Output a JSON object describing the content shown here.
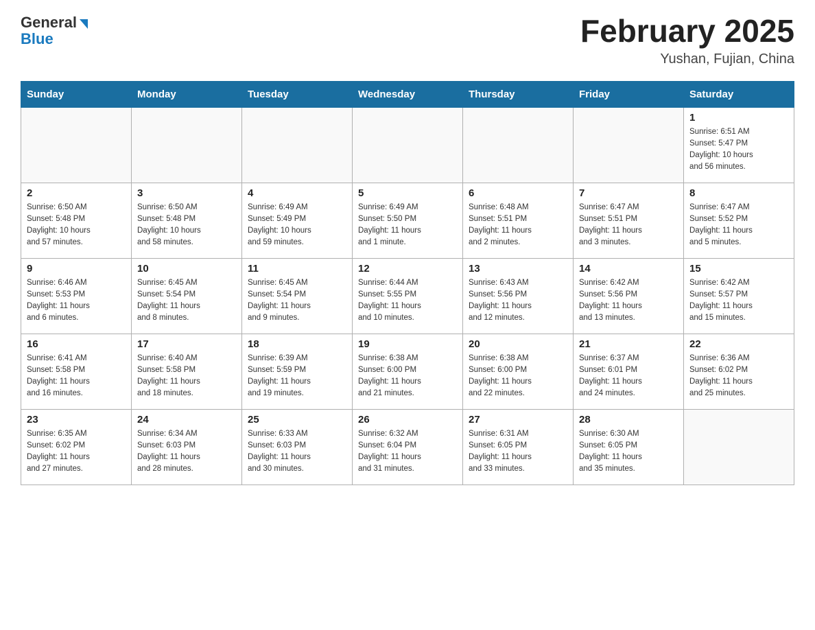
{
  "header": {
    "logo_general": "General",
    "logo_blue": "Blue",
    "title": "February 2025",
    "subtitle": "Yushan, Fujian, China"
  },
  "weekdays": [
    "Sunday",
    "Monday",
    "Tuesday",
    "Wednesday",
    "Thursday",
    "Friday",
    "Saturday"
  ],
  "weeks": [
    [
      {
        "day": "",
        "info": ""
      },
      {
        "day": "",
        "info": ""
      },
      {
        "day": "",
        "info": ""
      },
      {
        "day": "",
        "info": ""
      },
      {
        "day": "",
        "info": ""
      },
      {
        "day": "",
        "info": ""
      },
      {
        "day": "1",
        "info": "Sunrise: 6:51 AM\nSunset: 5:47 PM\nDaylight: 10 hours\nand 56 minutes."
      }
    ],
    [
      {
        "day": "2",
        "info": "Sunrise: 6:50 AM\nSunset: 5:48 PM\nDaylight: 10 hours\nand 57 minutes."
      },
      {
        "day": "3",
        "info": "Sunrise: 6:50 AM\nSunset: 5:48 PM\nDaylight: 10 hours\nand 58 minutes."
      },
      {
        "day": "4",
        "info": "Sunrise: 6:49 AM\nSunset: 5:49 PM\nDaylight: 10 hours\nand 59 minutes."
      },
      {
        "day": "5",
        "info": "Sunrise: 6:49 AM\nSunset: 5:50 PM\nDaylight: 11 hours\nand 1 minute."
      },
      {
        "day": "6",
        "info": "Sunrise: 6:48 AM\nSunset: 5:51 PM\nDaylight: 11 hours\nand 2 minutes."
      },
      {
        "day": "7",
        "info": "Sunrise: 6:47 AM\nSunset: 5:51 PM\nDaylight: 11 hours\nand 3 minutes."
      },
      {
        "day": "8",
        "info": "Sunrise: 6:47 AM\nSunset: 5:52 PM\nDaylight: 11 hours\nand 5 minutes."
      }
    ],
    [
      {
        "day": "9",
        "info": "Sunrise: 6:46 AM\nSunset: 5:53 PM\nDaylight: 11 hours\nand 6 minutes."
      },
      {
        "day": "10",
        "info": "Sunrise: 6:45 AM\nSunset: 5:54 PM\nDaylight: 11 hours\nand 8 minutes."
      },
      {
        "day": "11",
        "info": "Sunrise: 6:45 AM\nSunset: 5:54 PM\nDaylight: 11 hours\nand 9 minutes."
      },
      {
        "day": "12",
        "info": "Sunrise: 6:44 AM\nSunset: 5:55 PM\nDaylight: 11 hours\nand 10 minutes."
      },
      {
        "day": "13",
        "info": "Sunrise: 6:43 AM\nSunset: 5:56 PM\nDaylight: 11 hours\nand 12 minutes."
      },
      {
        "day": "14",
        "info": "Sunrise: 6:42 AM\nSunset: 5:56 PM\nDaylight: 11 hours\nand 13 minutes."
      },
      {
        "day": "15",
        "info": "Sunrise: 6:42 AM\nSunset: 5:57 PM\nDaylight: 11 hours\nand 15 minutes."
      }
    ],
    [
      {
        "day": "16",
        "info": "Sunrise: 6:41 AM\nSunset: 5:58 PM\nDaylight: 11 hours\nand 16 minutes."
      },
      {
        "day": "17",
        "info": "Sunrise: 6:40 AM\nSunset: 5:58 PM\nDaylight: 11 hours\nand 18 minutes."
      },
      {
        "day": "18",
        "info": "Sunrise: 6:39 AM\nSunset: 5:59 PM\nDaylight: 11 hours\nand 19 minutes."
      },
      {
        "day": "19",
        "info": "Sunrise: 6:38 AM\nSunset: 6:00 PM\nDaylight: 11 hours\nand 21 minutes."
      },
      {
        "day": "20",
        "info": "Sunrise: 6:38 AM\nSunset: 6:00 PM\nDaylight: 11 hours\nand 22 minutes."
      },
      {
        "day": "21",
        "info": "Sunrise: 6:37 AM\nSunset: 6:01 PM\nDaylight: 11 hours\nand 24 minutes."
      },
      {
        "day": "22",
        "info": "Sunrise: 6:36 AM\nSunset: 6:02 PM\nDaylight: 11 hours\nand 25 minutes."
      }
    ],
    [
      {
        "day": "23",
        "info": "Sunrise: 6:35 AM\nSunset: 6:02 PM\nDaylight: 11 hours\nand 27 minutes."
      },
      {
        "day": "24",
        "info": "Sunrise: 6:34 AM\nSunset: 6:03 PM\nDaylight: 11 hours\nand 28 minutes."
      },
      {
        "day": "25",
        "info": "Sunrise: 6:33 AM\nSunset: 6:03 PM\nDaylight: 11 hours\nand 30 minutes."
      },
      {
        "day": "26",
        "info": "Sunrise: 6:32 AM\nSunset: 6:04 PM\nDaylight: 11 hours\nand 31 minutes."
      },
      {
        "day": "27",
        "info": "Sunrise: 6:31 AM\nSunset: 6:05 PM\nDaylight: 11 hours\nand 33 minutes."
      },
      {
        "day": "28",
        "info": "Sunrise: 6:30 AM\nSunset: 6:05 PM\nDaylight: 11 hours\nand 35 minutes."
      },
      {
        "day": "",
        "info": ""
      }
    ]
  ]
}
